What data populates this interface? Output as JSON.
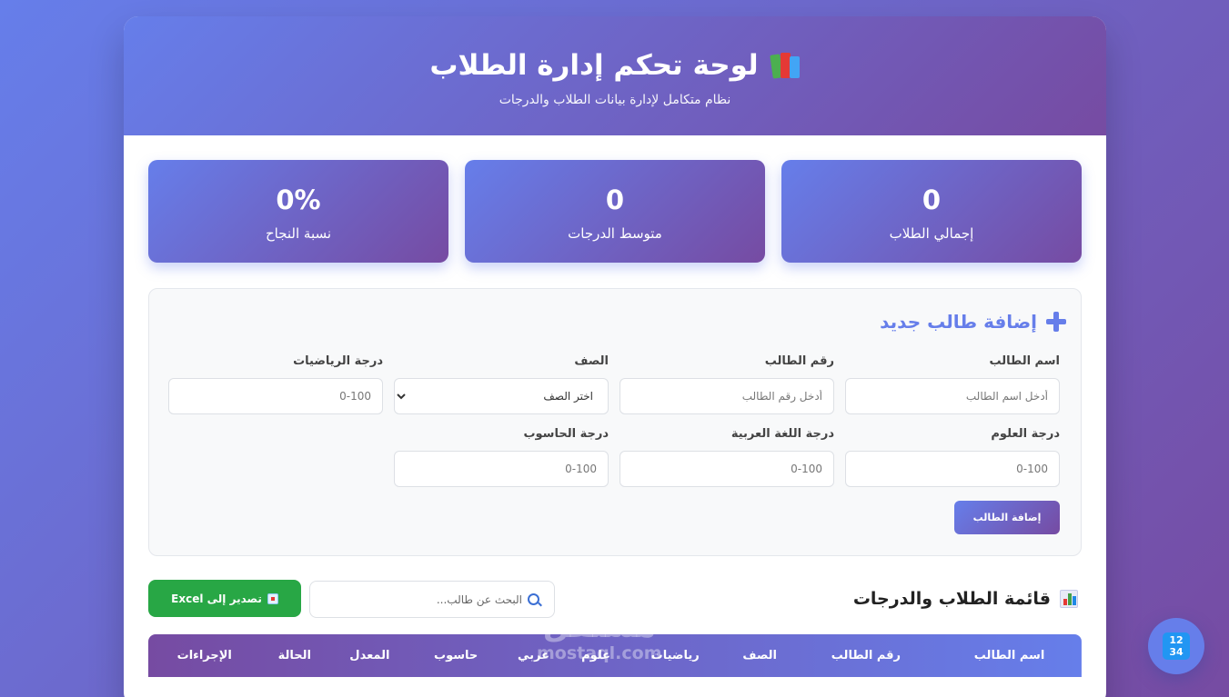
{
  "header": {
    "title": "لوحة تحكم إدارة الطلاب",
    "subtitle": "نظام متكامل لإدارة بيانات الطلاب والدرجات",
    "icon": "books-icon"
  },
  "stats": [
    {
      "value": "0",
      "label": "إجمالي الطلاب"
    },
    {
      "value": "0",
      "label": "متوسط الدرجات"
    },
    {
      "value": "0%",
      "label": "نسبة النجاح"
    }
  ],
  "form": {
    "title": "إضافة طالب جديد",
    "fields": {
      "name": {
        "label": "اسم الطالب",
        "placeholder": "أدخل اسم الطالب"
      },
      "id": {
        "label": "رقم الطالب",
        "placeholder": "أدخل رقم الطالب"
      },
      "grade": {
        "label": "الصف",
        "selected": "اختر الصف"
      },
      "math": {
        "label": "درجة الرياضيات",
        "placeholder": "0-100"
      },
      "science": {
        "label": "درجة العلوم",
        "placeholder": "0-100"
      },
      "arabic": {
        "label": "درجة اللغة العربية",
        "placeholder": "0-100"
      },
      "computer": {
        "label": "درجة الحاسوب",
        "placeholder": "0-100"
      }
    },
    "submit_label": "إضافة الطالب"
  },
  "list": {
    "title": "قائمة الطلاب والدرجات",
    "search_placeholder": "البحث عن طالب...",
    "export_label": "تصدير إلى Excel"
  },
  "table": {
    "headers": [
      "اسم الطالب",
      "رقم الطالب",
      "الصف",
      "رياضيات",
      "علوم",
      "عربي",
      "حاسوب",
      "المعدل",
      "الحالة",
      "الإجراءات"
    ]
  },
  "watermark": {
    "arabic": "مستقل",
    "latin": "mostaql.com"
  },
  "fab": {
    "glyph_top": "12",
    "glyph_bottom": "34"
  },
  "colors": {
    "accent_start": "#667eea",
    "accent_end": "#764ba2",
    "export_green": "#28a745"
  }
}
